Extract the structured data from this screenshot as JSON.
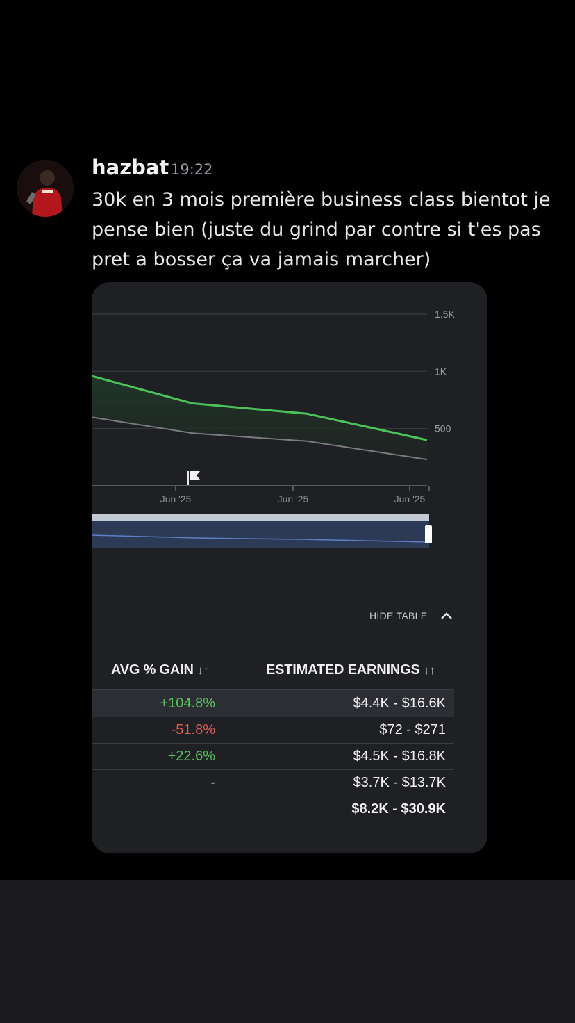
{
  "message": {
    "username": "hazbat",
    "time": "19:22",
    "text": "30k en 3 mois première business class bientot je pense bien (juste du grind par contre si t'es pas pret a bosser ça va jamais marcher)"
  },
  "chart_data": {
    "type": "line",
    "x": [
      "",
      "Jun '25",
      "",
      "Jun '25",
      "",
      "Jun '25"
    ],
    "series": [
      {
        "values": [
          960,
          720,
          630,
          400
        ]
      },
      {
        "values": [
          600,
          460,
          390,
          230
        ]
      }
    ],
    "y_ticks": [
      "1.5K",
      "1K",
      "500"
    ],
    "x_tick_labels": [
      "Jun '25",
      "Jun '25",
      "Jun '25"
    ],
    "ylim": [
      0,
      1500
    ],
    "grid": true,
    "colors": {
      "upper": "#4cc35a",
      "lower": "#7a7c80"
    }
  },
  "table": {
    "toggle_label": "HIDE TABLE",
    "headers": {
      "gain": "AVG % GAIN",
      "earnings": "ESTIMATED EARNINGS",
      "sort_glyph": "↓↑"
    },
    "rows": [
      {
        "gain": "+104.8%",
        "earnings": "$4.4K  -  $16.6K",
        "status": "pos"
      },
      {
        "gain": "-51.8%",
        "earnings": "$72  -  $271",
        "status": "neg"
      },
      {
        "gain": "+22.6%",
        "earnings": "$4.5K  -  $16.8K",
        "status": "pos"
      },
      {
        "gain": "-",
        "earnings": "$3.7K  -  $13.7K",
        "status": "neu"
      },
      {
        "gain": "",
        "earnings": "$8.2K  -  $30.9K",
        "status": "total"
      }
    ]
  }
}
